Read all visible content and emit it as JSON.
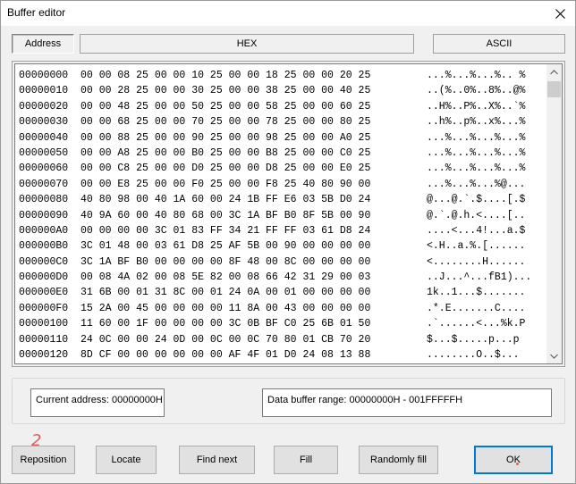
{
  "window": {
    "title": "Buffer editor"
  },
  "headers": {
    "address": "Address",
    "hex": "HEX",
    "ascii": "ASCII"
  },
  "hex_rows": [
    {
      "address": "00000000",
      "bytes": "00 00 08 25 00 00 10 25 00 00 18 25 00 00 20 25",
      "ascii": "...%...%...%.. %"
    },
    {
      "address": "00000010",
      "bytes": "00 00 28 25 00 00 30 25 00 00 38 25 00 00 40 25",
      "ascii": "..(%..0%..8%..@%"
    },
    {
      "address": "00000020",
      "bytes": "00 00 48 25 00 00 50 25 00 00 58 25 00 00 60 25",
      "ascii": "..H%..P%..X%..`%"
    },
    {
      "address": "00000030",
      "bytes": "00 00 68 25 00 00 70 25 00 00 78 25 00 00 80 25",
      "ascii": "..h%..p%..x%...%"
    },
    {
      "address": "00000040",
      "bytes": "00 00 88 25 00 00 90 25 00 00 98 25 00 00 A0 25",
      "ascii": "...%...%...%...%"
    },
    {
      "address": "00000050",
      "bytes": "00 00 A8 25 00 00 B0 25 00 00 B8 25 00 00 C0 25",
      "ascii": "...%...%...%...%"
    },
    {
      "address": "00000060",
      "bytes": "00 00 C8 25 00 00 D0 25 00 00 D8 25 00 00 E0 25",
      "ascii": "...%...%...%...%"
    },
    {
      "address": "00000070",
      "bytes": "00 00 E8 25 00 00 F0 25 00 00 F8 25 40 80 90 00",
      "ascii": "...%...%...%@..."
    },
    {
      "address": "00000080",
      "bytes": "40 80 98 00 40 1A 60 00 24 1B FF E6 03 5B D0 24",
      "ascii": "@...@.`.$....[.$"
    },
    {
      "address": "00000090",
      "bytes": "40 9A 60 00 40 80 68 00 3C 1A BF B0 8F 5B 00 90",
      "ascii": "@.`.@.h.<....[.."
    },
    {
      "address": "000000A0",
      "bytes": "00 00 00 00 3C 01 83 FF 34 21 FF FF 03 61 D8 24",
      "ascii": "....<...4!...a.$"
    },
    {
      "address": "000000B0",
      "bytes": "3C 01 48 00 03 61 D8 25 AF 5B 00 90 00 00 00 00",
      "ascii": "<.H..a.%.[......"
    },
    {
      "address": "000000C0",
      "bytes": "3C 1A BF B0 00 00 00 00 8F 48 00 8C 00 00 00 00",
      "ascii": "<........H......"
    },
    {
      "address": "000000D0",
      "bytes": "00 08 4A 02 00 08 5E 82 00 08 66 42 31 29 00 03",
      "ascii": "..J...^...fB1)..."
    },
    {
      "address": "000000E0",
      "bytes": "31 6B 00 01 31 8C 00 01 24 0A 00 01 00 00 00 00",
      "ascii": "1k..1...$......."
    },
    {
      "address": "000000F0",
      "bytes": "15 2A 00 45 00 00 00 00 11 8A 00 43 00 00 00 00",
      "ascii": ".*.E.......C...."
    },
    {
      "address": "00000100",
      "bytes": "11 60 00 1F 00 00 00 00 3C 0B BF C0 25 6B 01 50",
      "ascii": ".`......<...%k.P"
    },
    {
      "address": "00000110",
      "bytes": "24 0C 00 00 24 0D 00 0C 00 0C 70 80 01 CB 70 20",
      "ascii": "$...$.....p...p "
    },
    {
      "address": "00000120",
      "bytes": "8D CF 00 00 00 00 00 00 AF 4F 01 D0 24 08 13 88",
      "ascii": "........O..$..."
    }
  ],
  "info": {
    "current_address": "Current address: 00000000H",
    "data_buffer_range": "Data buffer range: 00000000H - 001FFFFFH"
  },
  "buttons": {
    "reposition": "Reposition",
    "locate": "Locate",
    "find_next": "Find next",
    "fill": "Fill",
    "randomly_fill": "Randomly fill",
    "ok": "OK"
  },
  "annotation": {
    "mark": "2",
    "color": "#e06060"
  },
  "icons": {
    "close": "close-icon",
    "scroll_up": "chevron-up-icon",
    "scroll_down": "chevron-down-icon"
  },
  "colors": {
    "accent": "#0078d7",
    "panel": "#f0f0f0"
  }
}
